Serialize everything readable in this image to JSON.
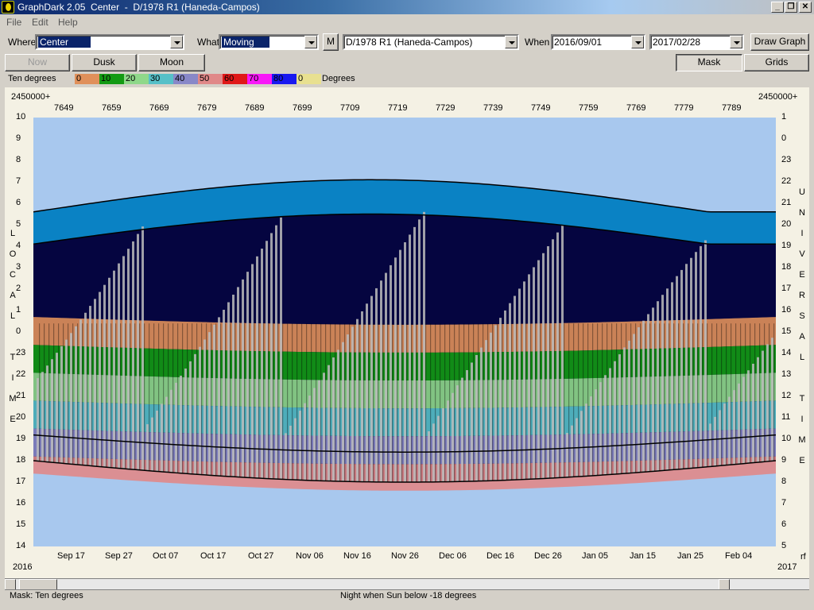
{
  "window": {
    "title": "GraphDark 2.05  Center  -  D/1978 R1 (Haneda-Campos)"
  },
  "menu": [
    "File",
    "Edit",
    "Help"
  ],
  "toolbar": {
    "where_label": "Where",
    "where_value": "Center",
    "what_label": "What",
    "what_value": "Moving",
    "m_button": "M",
    "object_value": "D/1978 R1 (Haneda-Campos)",
    "when_label": "When",
    "start_date": "2016/09/01",
    "end_date": "2017/02/28",
    "draw_button": "Draw Graph"
  },
  "buttons": {
    "now": "Now",
    "dusk": "Dusk",
    "moon": "Moon",
    "mask": "Mask",
    "grids": "Grids"
  },
  "legend": {
    "title": "Ten degrees",
    "units": "Degrees",
    "bands": [
      {
        "label": "0",
        "color": "#e0905a"
      },
      {
        "label": "10",
        "color": "#139a13"
      },
      {
        "label": "20",
        "color": "#8fd88a"
      },
      {
        "label": "30",
        "color": "#56c0c8"
      },
      {
        "label": "40",
        "color": "#8888c8"
      },
      {
        "label": "50",
        "color": "#e08888"
      },
      {
        "label": "60",
        "color": "#e01818"
      },
      {
        "label": "70",
        "color": "#f818f8"
      },
      {
        "label": "80",
        "color": "#1818f0"
      },
      {
        "label": "0",
        "color": "#e8e090"
      }
    ]
  },
  "graph": {
    "top_left_label": "2450000+",
    "top_right_label": "2450000+",
    "jd_ticks": [
      "7649",
      "7659",
      "7669",
      "7679",
      "7689",
      "7699",
      "7709",
      "7719",
      "7729",
      "7739",
      "7749",
      "7759",
      "7769",
      "7779",
      "7789"
    ],
    "date_ticks": [
      "Sep 17",
      "Sep 27",
      "Oct 07",
      "Oct 17",
      "Oct 27",
      "Nov 06",
      "Nov 16",
      "Nov 26",
      "Dec 06",
      "Dec 16",
      "Dec 26",
      "Jan 05",
      "Jan 15",
      "Jan 25",
      "Feb 04"
    ],
    "year_left": "2016",
    "year_right": "2017",
    "corner_right": "rf",
    "left_hours": [
      "10",
      "9",
      "8",
      "7",
      "6",
      "5",
      "4",
      "3",
      "2",
      "1",
      "0",
      "23",
      "22",
      "21",
      "20",
      "19",
      "18",
      "17",
      "16",
      "15",
      "14"
    ],
    "right_hours": [
      "1",
      "0",
      "23",
      "22",
      "21",
      "20",
      "19",
      "18",
      "17",
      "16",
      "15",
      "14",
      "13",
      "12",
      "11",
      "10",
      "9",
      "8",
      "7",
      "6",
      "5"
    ],
    "left_vertical": [
      "L",
      "O",
      "C",
      "A",
      "L",
      "",
      "T",
      "I",
      "M",
      "E"
    ],
    "right_vertical": [
      "U",
      "N",
      "I",
      "V",
      "E",
      "R",
      "S",
      "A",
      "L",
      "",
      "T",
      "I",
      "M",
      "E"
    ],
    "colors": {
      "sky_bg": "#a8c8ee",
      "night": "#050540",
      "twilight": "#0a82c4",
      "bars": "#bcbcbc"
    }
  },
  "status": {
    "mask": "Mask:  Ten degrees",
    "night": "Night when Sun below -18 degrees"
  }
}
